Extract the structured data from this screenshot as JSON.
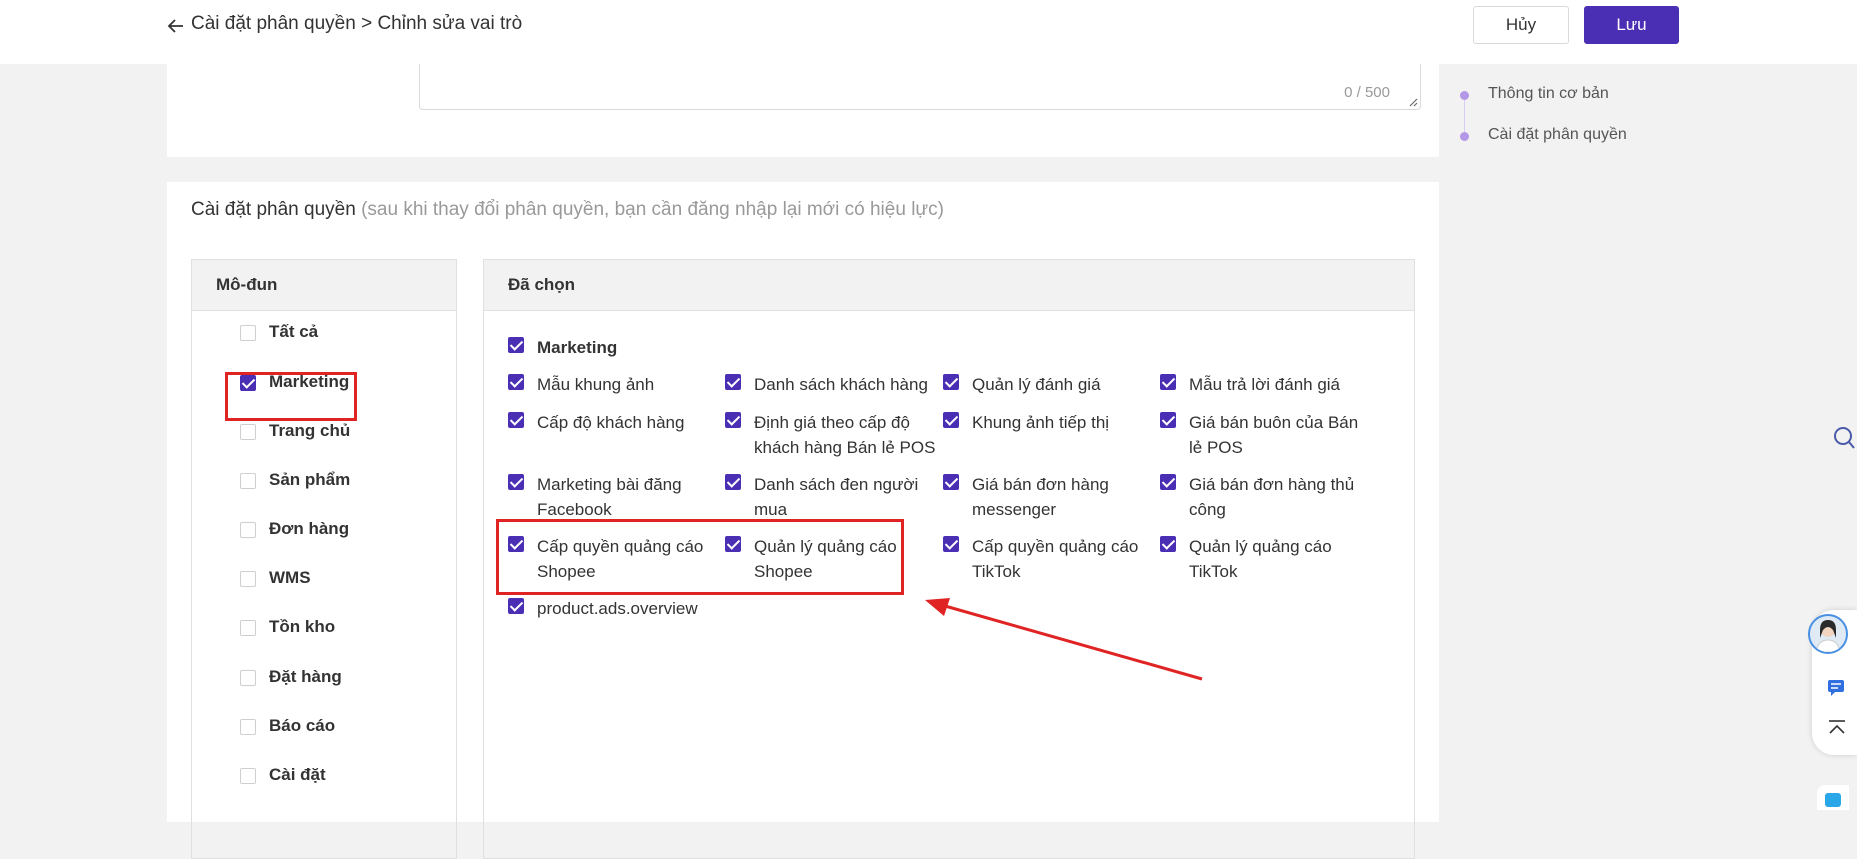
{
  "header": {
    "breadcrumb": "Cài đặt phân quyền > Chỉnh sửa vai trò",
    "cancel_label": "Hủy",
    "save_label": "Lưu"
  },
  "description": {
    "counter": "0 / 500"
  },
  "permission_section": {
    "title": "Cài đặt phân quyền",
    "note": "(sau khi thay đổi phân quyền, bạn cần đăng nhập lại mới có hiệu lực)"
  },
  "module_panel": {
    "header": "Mô-đun",
    "items": [
      {
        "label": "Tất cả",
        "checked": false
      },
      {
        "label": "Marketing",
        "checked": true
      },
      {
        "label": "Trang chủ",
        "checked": false
      },
      {
        "label": "Sản phẩm",
        "checked": false
      },
      {
        "label": "Đơn hàng",
        "checked": false
      },
      {
        "label": "WMS",
        "checked": false
      },
      {
        "label": "Tồn kho",
        "checked": false
      },
      {
        "label": "Đặt hàng",
        "checked": false
      },
      {
        "label": "Báo cáo",
        "checked": false
      },
      {
        "label": "Cài đặt",
        "checked": false
      }
    ]
  },
  "selected_panel": {
    "header": "Đã chọn",
    "group_label": "Marketing",
    "permissions": [
      "Mẫu khung ảnh",
      "Danh sách khách hàng",
      "Quản lý đánh giá",
      "Mẫu trả lời đánh giá",
      "Cấp độ khách hàng",
      "Định giá theo cấp độ khách hàng Bán lẻ POS",
      "Khung ảnh tiếp thị",
      "Giá bán buôn của Bán lẻ POS",
      "Marketing bài đăng Facebook",
      "Danh sách đen người mua",
      "Giá bán đơn hàng messenger",
      "Giá bán đơn hàng thủ công",
      "Cấp quyền quảng cáo Shopee",
      "Quản lý quảng cáo Shopee",
      "Cấp quyền quảng cáo TikTok",
      "Quản lý quảng cáo TikTok",
      "product.ads.overview"
    ]
  },
  "outline_nav": {
    "items": [
      "Thông tin cơ bản",
      "Cài đặt phân quyền"
    ],
    "accent_color": "#b497e6"
  },
  "colors": {
    "primary": "#4a2fb5",
    "annotation_red": "#e02424"
  }
}
